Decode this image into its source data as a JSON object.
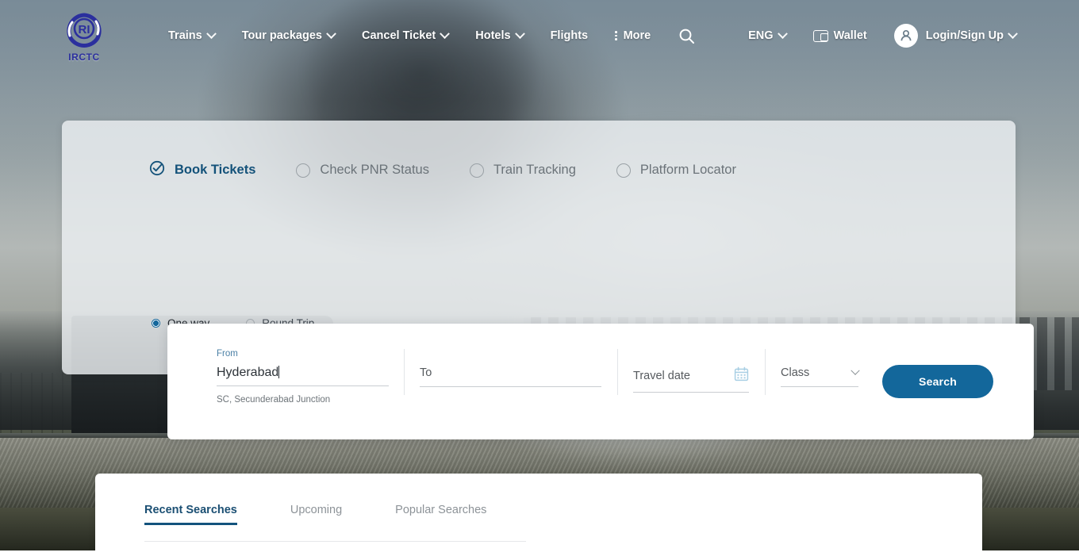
{
  "brand": {
    "name": "IRCTC",
    "monogram": "RI",
    "logo_color": "#2b2f9e"
  },
  "colors": {
    "accent_blue": "#13679b",
    "active_text": "#14527a",
    "tab_underline": "#13537d",
    "caption_blue": "#4a7fa5",
    "muted_text": "#8d9398"
  },
  "nav": {
    "items": [
      {
        "label": "Trains",
        "has_caret": true
      },
      {
        "label": "Tour packages",
        "has_caret": true
      },
      {
        "label": "Cancel Ticket",
        "has_caret": true
      },
      {
        "label": "Hotels",
        "has_caret": true
      },
      {
        "label": "Flights",
        "has_caret": false
      },
      {
        "label": "More",
        "has_caret": false,
        "icon": "kebab-menu-icon"
      }
    ],
    "search_icon": "search-icon",
    "right": {
      "language": "ENG",
      "wallet": "Wallet",
      "wallet_icon": "wallet-icon",
      "account": "Login/Sign Up",
      "account_icon": "user-avatar-icon"
    }
  },
  "modes": [
    {
      "label": "Book Tickets",
      "selected": true,
      "icon": "check-circle-icon"
    },
    {
      "label": "Check PNR Status",
      "selected": false,
      "icon": "radio-circle-icon"
    },
    {
      "label": "Train Tracking",
      "selected": false,
      "icon": "radio-circle-icon"
    },
    {
      "label": "Platform Locator",
      "selected": false,
      "icon": "radio-circle-icon"
    }
  ],
  "search_form": {
    "from": {
      "caption": "From",
      "value": "Hyderabad",
      "hint": "SC, Secunderabad Junction"
    },
    "to": {
      "placeholder": "To",
      "value": ""
    },
    "travel_date": {
      "placeholder": "Travel date",
      "value": "",
      "icon": "calendar-icon"
    },
    "travel_class": {
      "placeholder": "Class",
      "value": "",
      "icon": "chevron-down-icon"
    },
    "submit_label": "Search"
  },
  "trip_types": [
    {
      "label": "One way",
      "selected": true
    },
    {
      "label": "Round Trip",
      "selected": false
    }
  ],
  "bottom_tabs": [
    {
      "label": "Recent Searches",
      "active": true
    },
    {
      "label": "Upcoming",
      "active": false
    },
    {
      "label": "Popular Searches",
      "active": false
    }
  ]
}
